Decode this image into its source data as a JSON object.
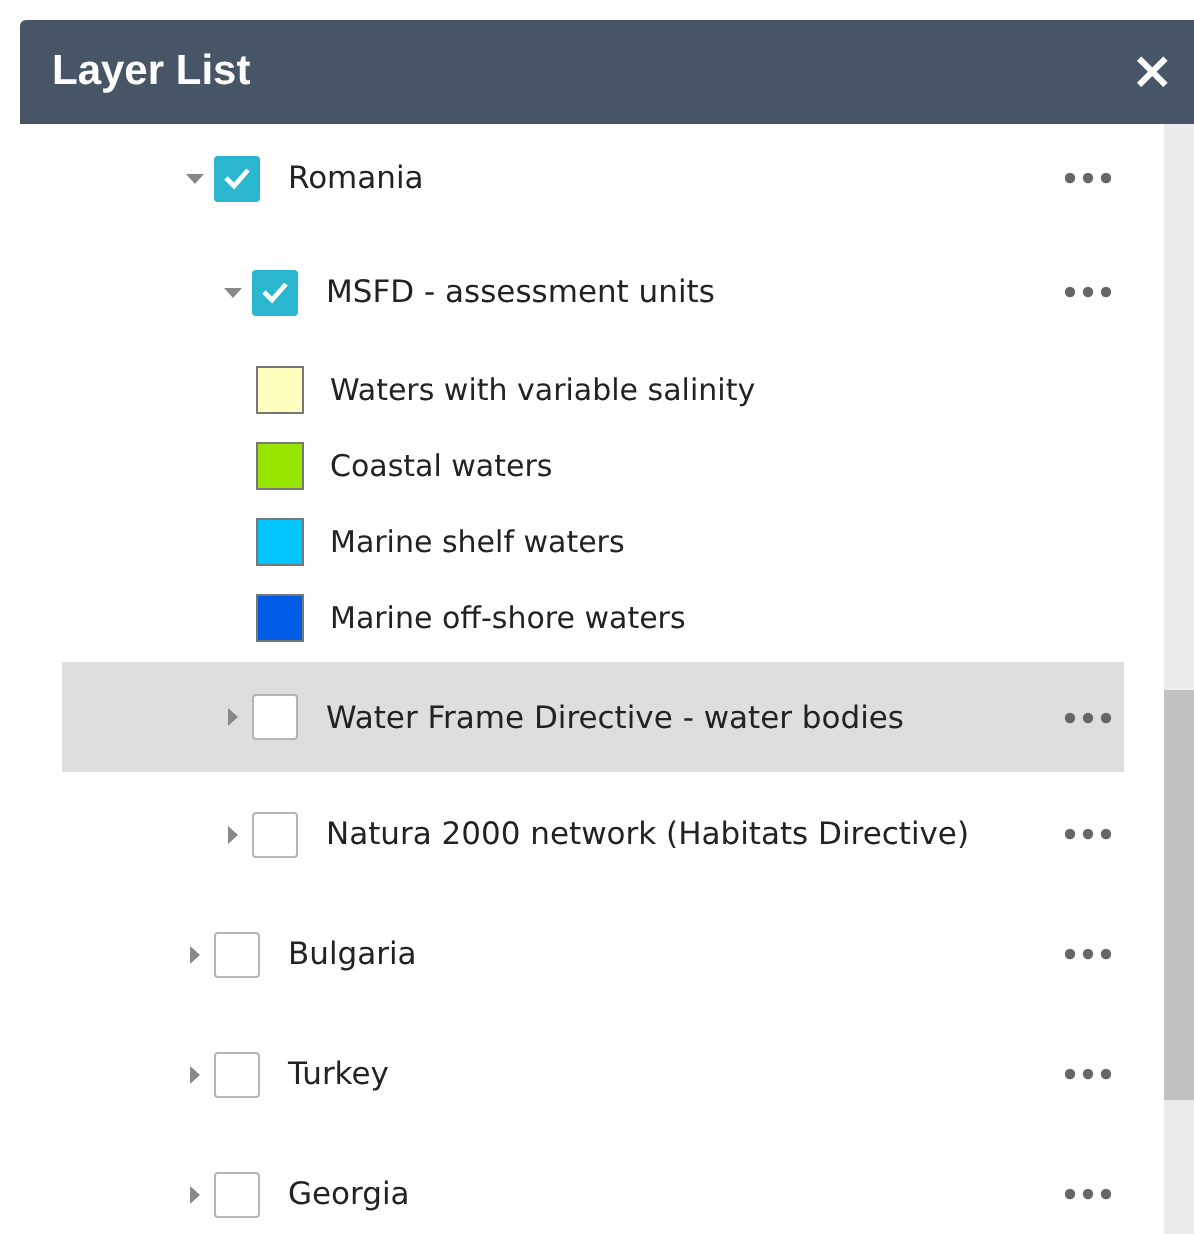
{
  "panel": {
    "title": "Layer List",
    "close": "×"
  },
  "layers": [
    {
      "title": "Romania",
      "checked": true,
      "expanded": true,
      "selected": false,
      "children": [
        {
          "title": "MSFD - assessment units",
          "checked": true,
          "expanded": true,
          "selected": false,
          "legend": [
            {
              "label": "Waters with variable salinity",
              "color": "#ffffc0"
            },
            {
              "label": "Coastal waters",
              "color": "#98e600"
            },
            {
              "label": "Marine shelf waters",
              "color": "#00c5ff"
            },
            {
              "label": "Marine off-shore waters",
              "color": "#005ce6"
            }
          ]
        },
        {
          "title": "Water Frame Directive - water bodies",
          "checked": false,
          "expanded": false,
          "selected": true
        },
        {
          "title": "Natura 2000 network (Habitats Directive)",
          "checked": false,
          "expanded": false,
          "selected": false
        }
      ]
    },
    {
      "title": "Bulgaria",
      "checked": false,
      "expanded": false,
      "selected": false
    },
    {
      "title": "Turkey",
      "checked": false,
      "expanded": false,
      "selected": false
    },
    {
      "title": "Georgia",
      "checked": false,
      "expanded": false,
      "selected": false
    }
  ]
}
